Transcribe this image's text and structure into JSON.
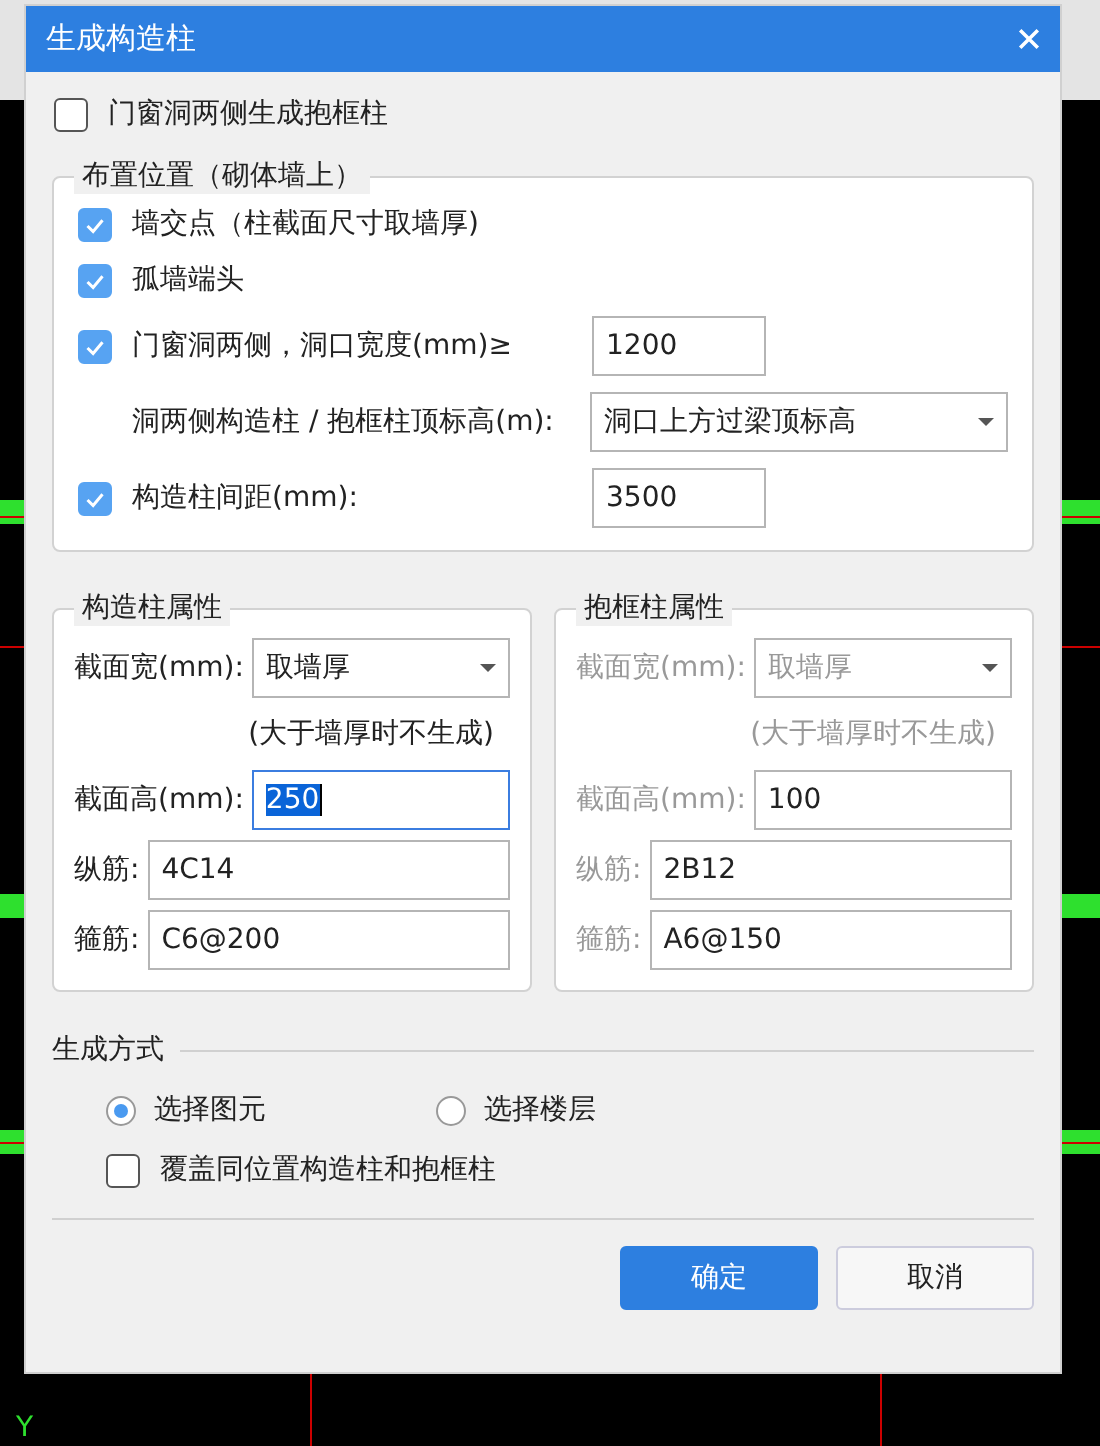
{
  "dialog": {
    "title": "生成构造柱"
  },
  "top_option": {
    "label": "门窗洞两侧生成抱框柱",
    "checked": false
  },
  "placement_group": {
    "title": "布置位置（砌体墙上）",
    "rows": [
      {
        "kind": "check",
        "label": "墙交点（柱截面尺寸取墙厚)",
        "checked": true
      },
      {
        "kind": "check",
        "label": "孤墙端头",
        "checked": true
      },
      {
        "kind": "check_input",
        "label": "门窗洞两侧，洞口宽度(mm)≥",
        "checked": true,
        "value": "1200"
      },
      {
        "kind": "select",
        "label": "洞两侧构造柱 / 抱框柱顶标高(m):",
        "value": "洞口上方过梁顶标高"
      },
      {
        "kind": "check_input",
        "label": "构造柱间距(mm):",
        "checked": true,
        "value": "3500"
      }
    ]
  },
  "property_groups": [
    {
      "title": "构造柱属性",
      "disabled": false,
      "fields": [
        {
          "kind": "select",
          "label": "截面宽(mm):",
          "value": "取墙厚"
        },
        {
          "kind": "note",
          "text": "(大于墙厚时不生成)"
        },
        {
          "kind": "input",
          "label": "截面高(mm):",
          "value": "250",
          "focused": true
        },
        {
          "kind": "input",
          "label": "纵筋:",
          "value": "4C14",
          "focused": false
        },
        {
          "kind": "input",
          "label": "箍筋:",
          "value": "C6@200",
          "focused": false
        }
      ]
    },
    {
      "title": "抱框柱属性",
      "disabled": true,
      "fields": [
        {
          "kind": "select",
          "label": "截面宽(mm):",
          "value": "取墙厚"
        },
        {
          "kind": "note",
          "text": "(大于墙厚时不生成)"
        },
        {
          "kind": "input",
          "label": "截面高(mm):",
          "value": "100",
          "focused": false
        },
        {
          "kind": "input",
          "label": "纵筋:",
          "value": "2B12",
          "focused": false
        },
        {
          "kind": "input",
          "label": "箍筋:",
          "value": "A6@150",
          "focused": false
        }
      ]
    }
  ],
  "method_group": {
    "title": "生成方式",
    "options": [
      {
        "label": "选择图元",
        "selected": true
      },
      {
        "label": "选择楼层",
        "selected": false
      }
    ],
    "overwrite": {
      "label": "覆盖同位置构造柱和抱框柱",
      "checked": false
    }
  },
  "buttons": [
    {
      "label": "确定",
      "primary": true
    },
    {
      "label": "取消",
      "primary": false
    }
  ],
  "canvas": {
    "axis_label": "Y"
  }
}
